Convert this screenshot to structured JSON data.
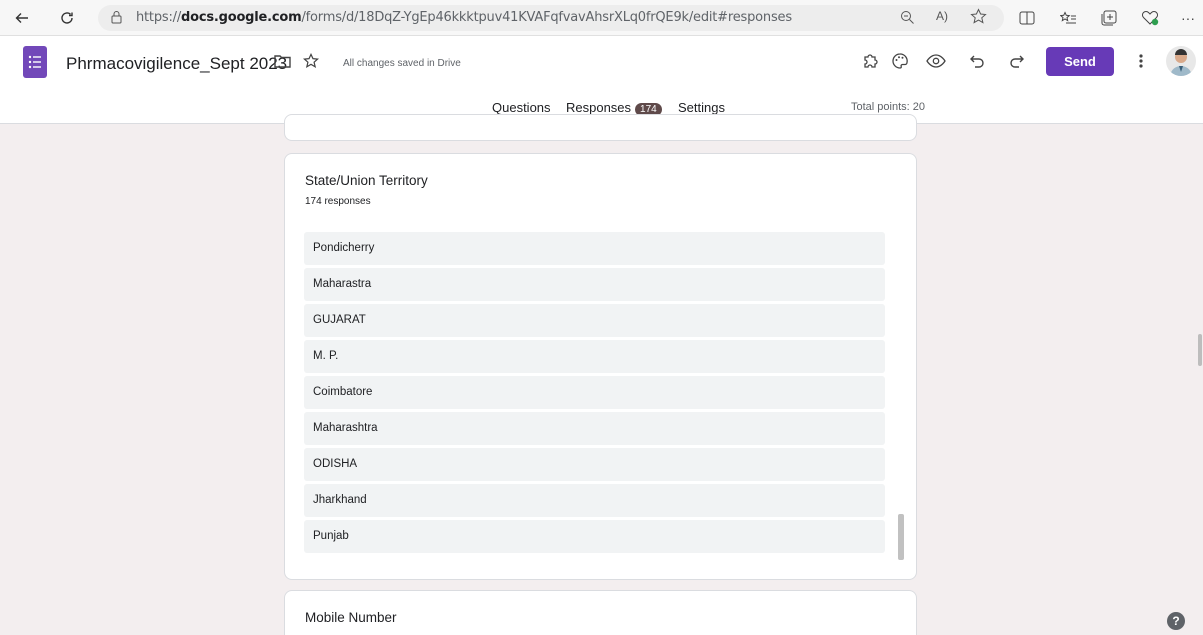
{
  "browser": {
    "url_prefix": "https://",
    "url_domain": "docs.google.com",
    "url_path": "/forms/d/18DqZ-YgEp46kkktpuv41KVAFqfvavAhsrXLq0frQE9k/edit#responses"
  },
  "header": {
    "title": "Phrmacovigilence_Sept 2023",
    "saved_status": "All changes saved in Drive",
    "send_label": "Send"
  },
  "tabs": {
    "questions": "Questions",
    "responses": "Responses",
    "responses_count": "174",
    "settings": "Settings",
    "total_points": "Total points: 20"
  },
  "question": {
    "title": "State/Union Territory",
    "count": "174 responses",
    "responses": [
      "Pondicherry",
      "Maharastra",
      "GUJARAT",
      "M. P.",
      "Coimbatore",
      "Maharashtra",
      "ODISHA",
      "Jharkhand",
      "Punjab"
    ]
  },
  "next_question": {
    "title": "Mobile Number"
  },
  "help": "?",
  "colors": {
    "accent": "#673ab7",
    "background": "#f3eeef"
  }
}
